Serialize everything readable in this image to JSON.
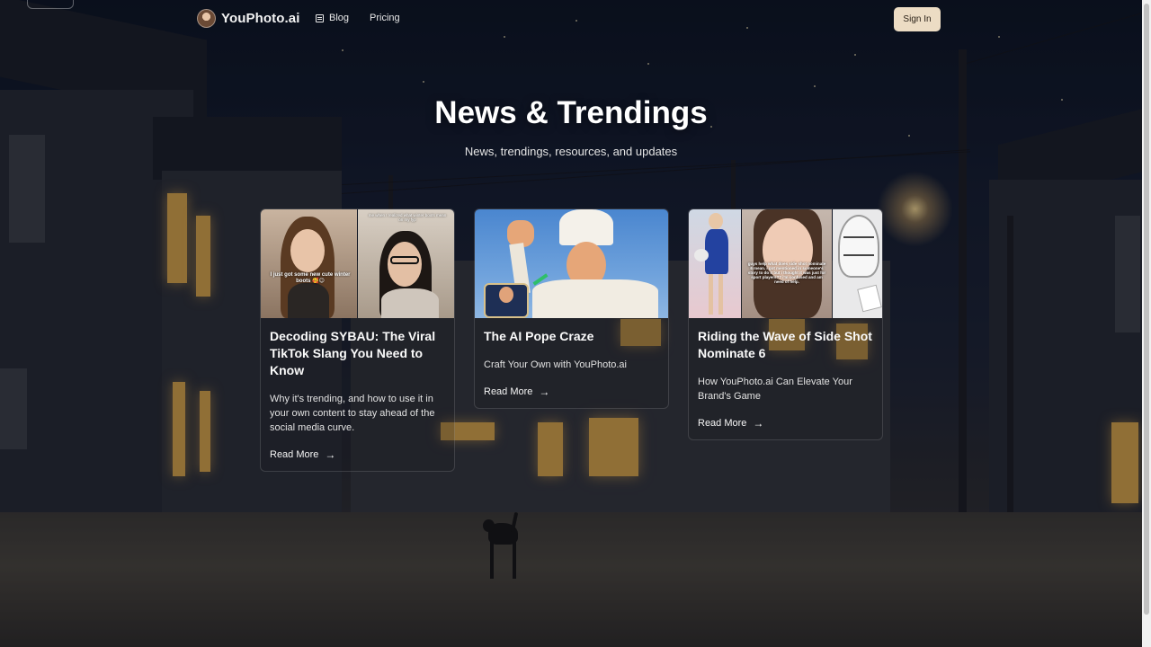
{
  "brand": {
    "name": "YouPhoto.ai"
  },
  "nav": {
    "blog_label": "Blog",
    "pricing_label": "Pricing",
    "signin_label": "Sign In"
  },
  "hero": {
    "title": "News & Trendings",
    "subtitle": "News, trendings, resources, and updates"
  },
  "cards": [
    {
      "title": "Decoding SYBAU: The Viral TikTok Slang You Need to Know",
      "description": "Why it's trending, and how to use it in your own content to stay ahead of the social media curve.",
      "link_label": "Read More",
      "image": {
        "caption_left": "I just got some new cute winter boots 🥰😊",
        "caption_right": "me when I realized what winter boots mean on my fyp"
      }
    },
    {
      "title": "The AI Pope Craze",
      "description": "Craft Your Own with YouPhoto.ai",
      "link_label": "Read More"
    },
    {
      "title": "Riding the Wave of Side Shot Nominate 6",
      "description": "How YouPhoto.ai Can Elevate Your Brand's Game",
      "link_label": "Read More",
      "image": {
        "caption_center": "guys help what does side shot nominate 6 mean. i got mentioned in someone's story to do it but i thought it was just for sport players?? i'm confused and am need of help."
      }
    }
  ],
  "icons": {
    "blog": "document-icon",
    "pricing": "credit-card-icon",
    "read_more": "arrow-right-icon"
  },
  "colors": {
    "signin_bg": "#ecdcc4",
    "text": "#f2f2f2",
    "window_light": "#d9a64a"
  }
}
